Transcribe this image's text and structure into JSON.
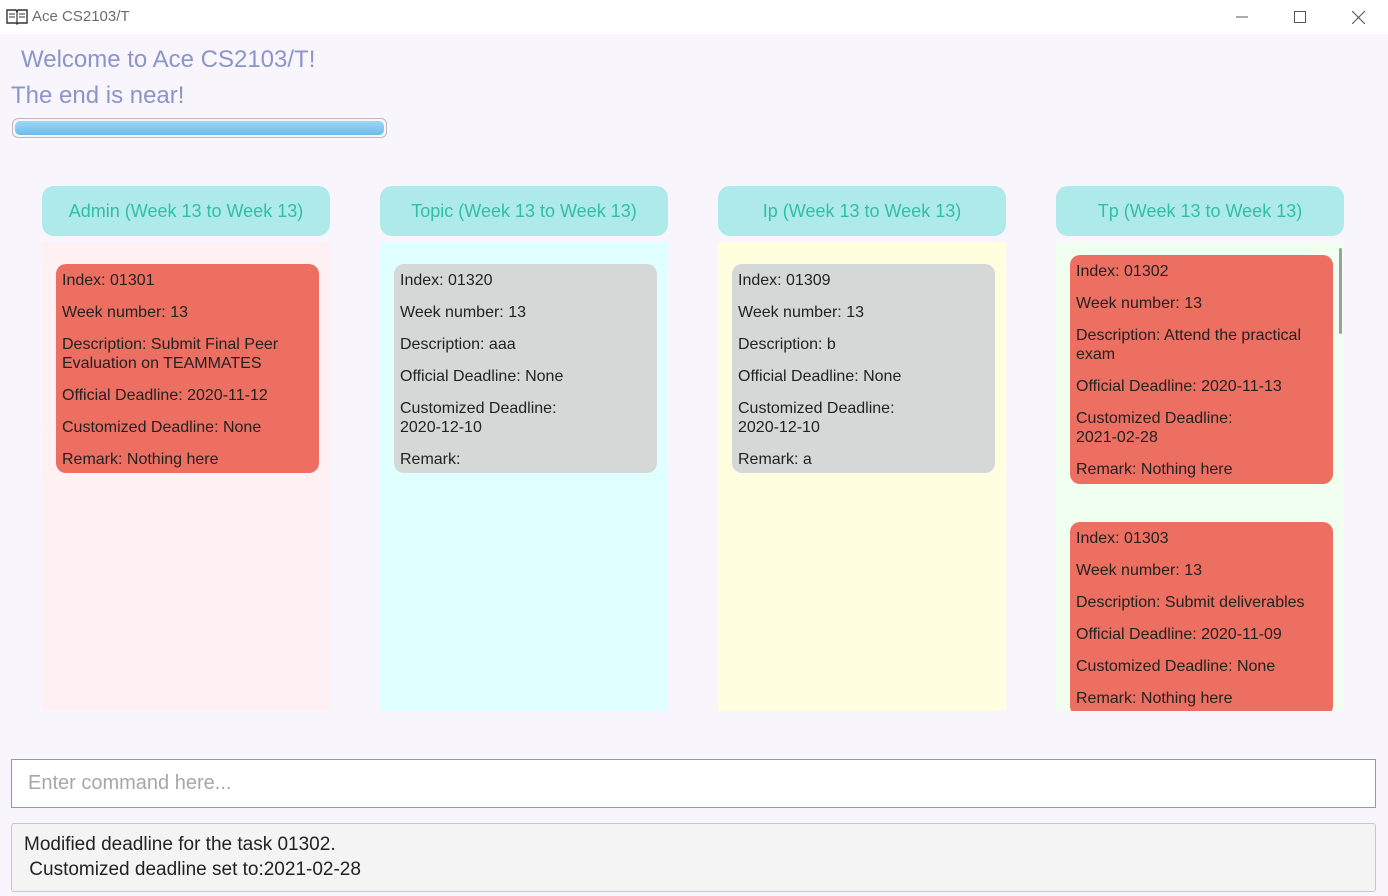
{
  "window": {
    "title": "Ace CS2103/T",
    "icon": "book-icon",
    "controls": [
      "minimize-icon",
      "maximize-icon",
      "close-icon"
    ]
  },
  "header": {
    "welcome": "Welcome to Ace CS2103/T!",
    "message": "The end is near!",
    "progress_fraction": 1.0
  },
  "columns": [
    {
      "title": "Admin (Week 13 to Week 13)",
      "cards": [
        {
          "color": "#ec6f61",
          "index": "Index: 01301",
          "week": "Week number: 13",
          "description": "Description: Submit Final Peer Evaluation on TEAMMATES",
          "official": "Official Deadline: 2020-11-12",
          "customized": "Customized Deadline: None",
          "remark": "Remark: Nothing here"
        }
      ]
    },
    {
      "title": "Topic (Week 13 to Week 13)",
      "cards": [
        {
          "color": "#d4d9d8",
          "index": "Index: 01320",
          "week": "Week number: 13",
          "description": "Description: aaa",
          "official": "Official Deadline: None",
          "customized": "Customized Deadline: 2020-12-10",
          "remark": "Remark:"
        }
      ]
    },
    {
      "title": "Ip (Week 13 to Week 13)",
      "cards": [
        {
          "color": "#d4d9d8",
          "index": "Index: 01309",
          "week": "Week number: 13",
          "description": "Description: b",
          "official": "Official Deadline: None",
          "customized": "Customized Deadline: 2020-12-10",
          "remark": "Remark: a"
        }
      ]
    },
    {
      "title": "Tp (Week 13 to Week 13)",
      "cards": [
        {
          "color": "#ec6f61",
          "index": "Index: 01302",
          "week": "Week number: 13",
          "description": "Description: Attend the practical exam",
          "official": "Official Deadline: 2020-11-13",
          "customized": "Customized Deadline: 2021-02-28",
          "remark": "Remark: Nothing here"
        },
        {
          "color": "#ec6f61",
          "index": "Index: 01303",
          "week": "Week number: 13",
          "description": "Description: Submit deliverables",
          "official": "Official Deadline: 2020-11-09",
          "customized": "Customized Deadline: None",
          "remark": "Remark: Nothing here"
        }
      ]
    }
  ],
  "command": {
    "placeholder": "Enter command here...",
    "value": ""
  },
  "result": {
    "text": "Modified deadline for the task 01302.\n Customized deadline set to:2021-02-28"
  }
}
